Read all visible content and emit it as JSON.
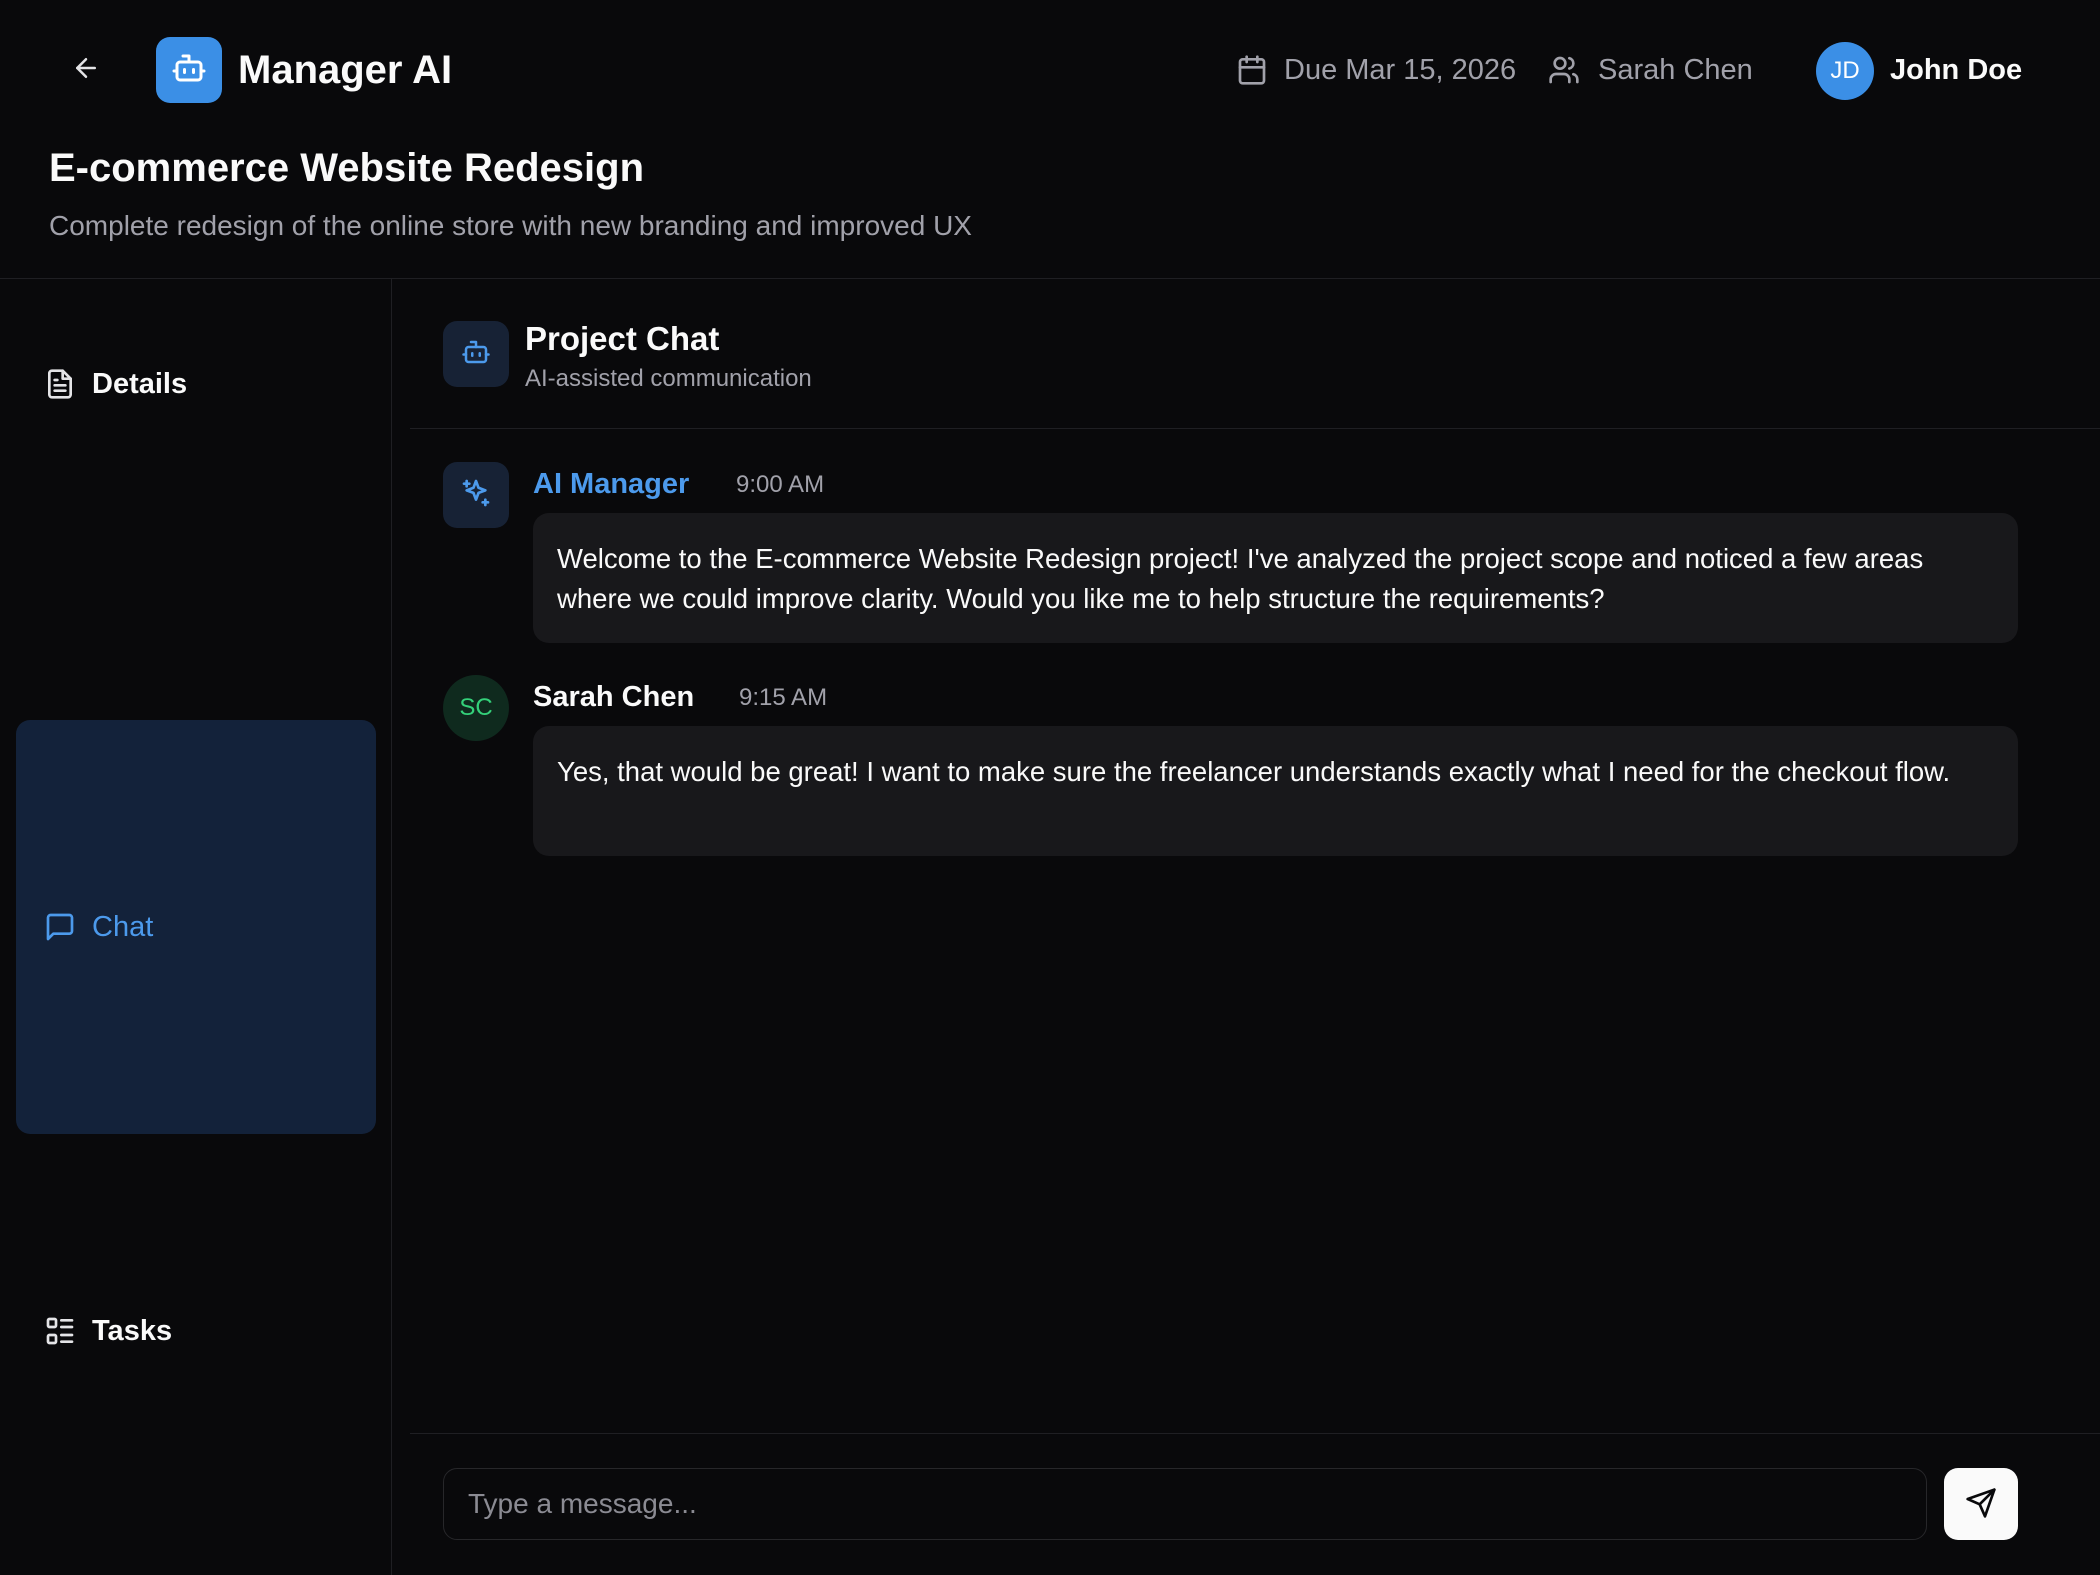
{
  "header": {
    "back_icon": "arrow-left-icon",
    "brand_icon": "bot-icon",
    "brand_name": "Manager AI",
    "due_icon": "calendar-icon",
    "due_text": "Due Mar 15, 2026",
    "owner_icon": "users-icon",
    "owner_name": "Sarah Chen",
    "user_initials": "JD",
    "user_name": "John Doe"
  },
  "project": {
    "title": "E-commerce Website Redesign",
    "description": "Complete redesign of the online store with new branding and improved UX"
  },
  "sidebar": {
    "items": [
      {
        "label": "Details",
        "icon": "file-text-icon",
        "active": false
      },
      {
        "label": "Chat",
        "icon": "message-square-icon",
        "active": true
      },
      {
        "label": "Tasks",
        "icon": "list-icon",
        "active": false
      }
    ]
  },
  "chat": {
    "header_icon": "bot-icon",
    "title": "Project Chat",
    "subtitle": "AI-assisted communication",
    "messages": [
      {
        "author": "AI Manager",
        "avatar_icon": "sparkles-icon",
        "time": "9:00 AM",
        "text": "Welcome to the E-commerce Website Redesign project! I've analyzed the project scope and noticed a few areas where we could improve clarity. Would you like me to help structure the requirements?"
      },
      {
        "author": "Sarah Chen",
        "avatar_initials": "SC",
        "time": "9:15 AM",
        "text": "Yes, that would be great! I want to make sure the freelancer understands exactly what I need for the checkout flow."
      }
    ],
    "composer": {
      "placeholder": "Type a message...",
      "value": "",
      "send_icon": "send-icon"
    }
  },
  "colors": {
    "background": "#09090b",
    "accent": "#3b8fe6",
    "accent_text": "#4c9aec",
    "active_nav_bg": "#13223a",
    "bubble_bg": "#18181b",
    "muted_text": "#a1a1aa",
    "user_avatar_text": "#34d17a"
  }
}
